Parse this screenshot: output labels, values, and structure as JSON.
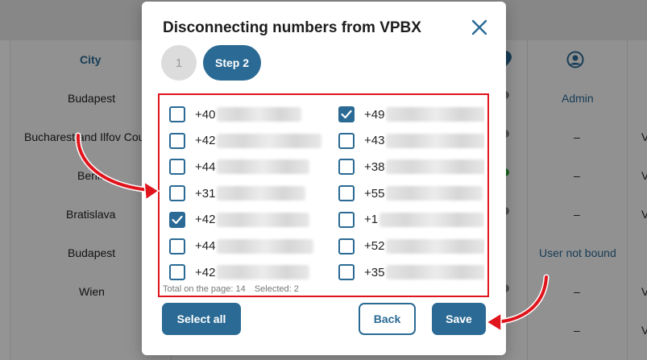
{
  "background": {
    "columns": {
      "city": "City",
      "admin": "Admin"
    },
    "cities": [
      "Budapest",
      "Bucharest and Ilfov Cou",
      "Berlin",
      "Bratislava",
      "Budapest",
      "Wien"
    ],
    "right_values": [
      "Admin",
      "–",
      "–",
      "–",
      "User not bound",
      "–",
      "–"
    ],
    "right_edge_letters": [
      "V",
      "V",
      "V",
      "V",
      "V"
    ]
  },
  "modal": {
    "title": "Disconnecting numbers from VPBX",
    "steps": [
      {
        "label": "1"
      },
      {
        "label": "Step 2"
      }
    ],
    "numbers": {
      "left": [
        {
          "prefix": "+40",
          "checked": false
        },
        {
          "prefix": "+42",
          "checked": false
        },
        {
          "prefix": "+44",
          "checked": false
        },
        {
          "prefix": "+31",
          "checked": false
        },
        {
          "prefix": "+42",
          "checked": true
        },
        {
          "prefix": "+44",
          "checked": false
        },
        {
          "prefix": "+42",
          "checked": false
        }
      ],
      "right": [
        {
          "prefix": "+49",
          "checked": true
        },
        {
          "prefix": "+43",
          "checked": false
        },
        {
          "prefix": "+38",
          "checked": false
        },
        {
          "prefix": "+55",
          "checked": false
        },
        {
          "prefix": "+1",
          "checked": false
        },
        {
          "prefix": "+52",
          "checked": false
        },
        {
          "prefix": "+35",
          "checked": false
        }
      ]
    },
    "footer": {
      "total": "Total on the page: 14",
      "selected": "Selected: 2"
    },
    "buttons": {
      "select_all": "Select all",
      "back": "Back",
      "save": "Save"
    }
  },
  "colors": {
    "primary": "#2a6a94",
    "highlight": "#e0141c"
  },
  "icons": {
    "close": "close-icon",
    "check": "check-icon",
    "location": "location-pin-icon",
    "user": "user-icon"
  }
}
